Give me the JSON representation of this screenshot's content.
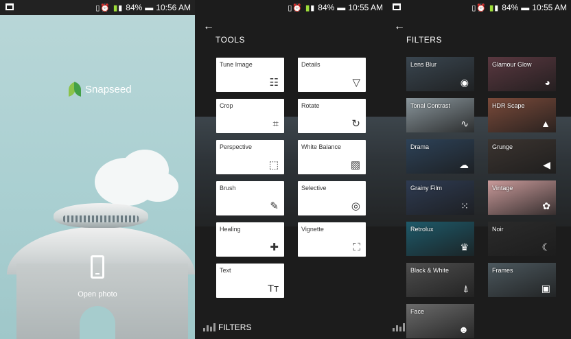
{
  "panels": [
    {
      "status": {
        "battery": "84%",
        "time": "10:56 AM"
      }
    },
    {
      "status": {
        "battery": "84%",
        "time": "10:55 AM"
      }
    },
    {
      "status": {
        "battery": "84%",
        "time": "10:55 AM"
      }
    }
  ],
  "splash": {
    "app_name": "Snapseed",
    "open_photo_label": "Open photo"
  },
  "tools": {
    "title": "TOOLS",
    "items": [
      {
        "label": "Tune Image",
        "icon": "sliders-icon",
        "glyph": "☷"
      },
      {
        "label": "Details",
        "icon": "triangle-down-icon",
        "glyph": "▽"
      },
      {
        "label": "Crop",
        "icon": "crop-icon",
        "glyph": "⌗"
      },
      {
        "label": "Rotate",
        "icon": "rotate-icon",
        "glyph": "↻"
      },
      {
        "label": "Perspective",
        "icon": "perspective-icon",
        "glyph": "⬚"
      },
      {
        "label": "White Balance",
        "icon": "white-balance-icon",
        "glyph": "▨"
      },
      {
        "label": "Brush",
        "icon": "brush-icon",
        "glyph": "✎"
      },
      {
        "label": "Selective",
        "icon": "selective-icon",
        "glyph": "◎"
      },
      {
        "label": "Healing",
        "icon": "bandage-icon",
        "glyph": "✚"
      },
      {
        "label": "Vignette",
        "icon": "vignette-icon",
        "glyph": "⛶"
      },
      {
        "label": "Text",
        "icon": "text-icon",
        "glyph": "Tт"
      }
    ],
    "bottom_label": "FILTERS"
  },
  "filters": {
    "title": "FILTERS",
    "items": [
      {
        "label": "Lens Blur",
        "icon": "target-icon",
        "glyph": "◉",
        "bg": "#3a4650"
      },
      {
        "label": "Glamour Glow",
        "icon": "eye-icon",
        "glyph": "◕",
        "bg": "#5a3840"
      },
      {
        "label": "Tonal Contrast",
        "icon": "pulse-icon",
        "glyph": "∿",
        "bg": "#8a969c"
      },
      {
        "label": "HDR Scape",
        "icon": "mountain-icon",
        "glyph": "▲",
        "bg": "#7a4a3a"
      },
      {
        "label": "Drama",
        "icon": "cloud-icon",
        "glyph": "☁",
        "bg": "#2d4258"
      },
      {
        "label": "Grunge",
        "icon": "megaphone-icon",
        "glyph": "◀",
        "bg": "#3b3430"
      },
      {
        "label": "Grainy Film",
        "icon": "film-grain-icon",
        "glyph": "⁙",
        "bg": "#2e3b52"
      },
      {
        "label": "Vintage",
        "icon": "gear-icon",
        "glyph": "✿",
        "bg": "#c99a9a"
      },
      {
        "label": "Retrolux",
        "icon": "retrolux-icon",
        "glyph": "♛",
        "bg": "#1e5a6a"
      },
      {
        "label": "Noir",
        "icon": "moon-icon",
        "glyph": "☾",
        "bg": "#2b2b2b"
      },
      {
        "label": "Black & White",
        "icon": "tower-icon",
        "glyph": "⍋",
        "bg": "#4e4e4e"
      },
      {
        "label": "Frames",
        "icon": "frame-icon",
        "glyph": "▣",
        "bg": "#4c585e"
      },
      {
        "label": "Face",
        "icon": "face-icon",
        "glyph": "☻",
        "bg": "#6b6b6b"
      }
    ]
  }
}
